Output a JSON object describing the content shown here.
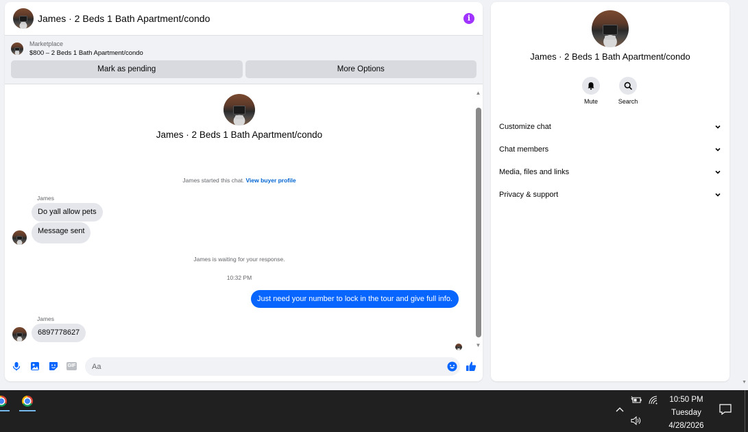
{
  "chat": {
    "header_title": "James · 2 Beds 1 Bath Apartment/condo",
    "info_icon": "info-icon",
    "listing": {
      "source": "Marketplace",
      "title": "$800 – 2 Beds 1 Bath Apartment/condo",
      "buttons": [
        "Mark as pending",
        "More Options"
      ]
    },
    "profile_name": "James · 2 Beds 1 Bath Apartment/condo",
    "started_text": "James started this chat.",
    "started_link": "View buyer profile",
    "sender": "James",
    "messages_in_1": [
      "Do yall allow pets",
      "Message sent"
    ],
    "waiting_text": "James is waiting for your response.",
    "timestamp": "10:32 PM",
    "message_out": "Just need your number to lock in the tour and give full info.",
    "sender_2": "James",
    "message_in_2": "6897778627",
    "composer": {
      "placeholder": "Aa",
      "icons": [
        "microphone-icon",
        "image-icon",
        "sticker-icon",
        "gif-icon",
        "emoji-icon",
        "thumbs-up-icon"
      ],
      "gif_label": "GIF"
    }
  },
  "info_panel": {
    "name": "James · 2 Beds 1 Bath Apartment/condo",
    "actions": [
      {
        "label": "Mute",
        "icon": "bell-icon"
      },
      {
        "label": "Search",
        "icon": "search-icon"
      }
    ],
    "sections": [
      "Customize chat",
      "Chat members",
      "Media, files and links",
      "Privacy & support"
    ]
  },
  "taskbar": {
    "time": "10:50 PM",
    "day": "Tuesday",
    "date": "4/28/2026"
  },
  "colors": {
    "accent": "#0866ff",
    "info": "#a033ff",
    "bubble_in": "#e4e6eb",
    "taskbar": "#202020"
  }
}
